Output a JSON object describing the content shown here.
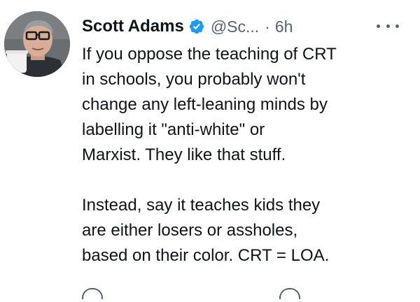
{
  "tweet": {
    "author_name": "Scott Adams",
    "handle": "@Sc...",
    "separator": "·",
    "time": "6h",
    "more_icon": "more-horizontal-icon",
    "verified_icon": "verified-badge-icon",
    "colors": {
      "verified": "#1d9bf0",
      "text": "#0f1419",
      "secondary": "#536471"
    },
    "paragraph1": [
      "If you oppose the teaching of CRT",
      "in schools, you probably won't",
      "change any left-leaning minds by",
      "labelling it \"anti-white\" or",
      "Marxist. They like that stuff."
    ],
    "paragraph2": [
      "Instead, say it teaches kids they",
      "are either losers or assholes,",
      "based on their color. CRT = LOA."
    ]
  }
}
